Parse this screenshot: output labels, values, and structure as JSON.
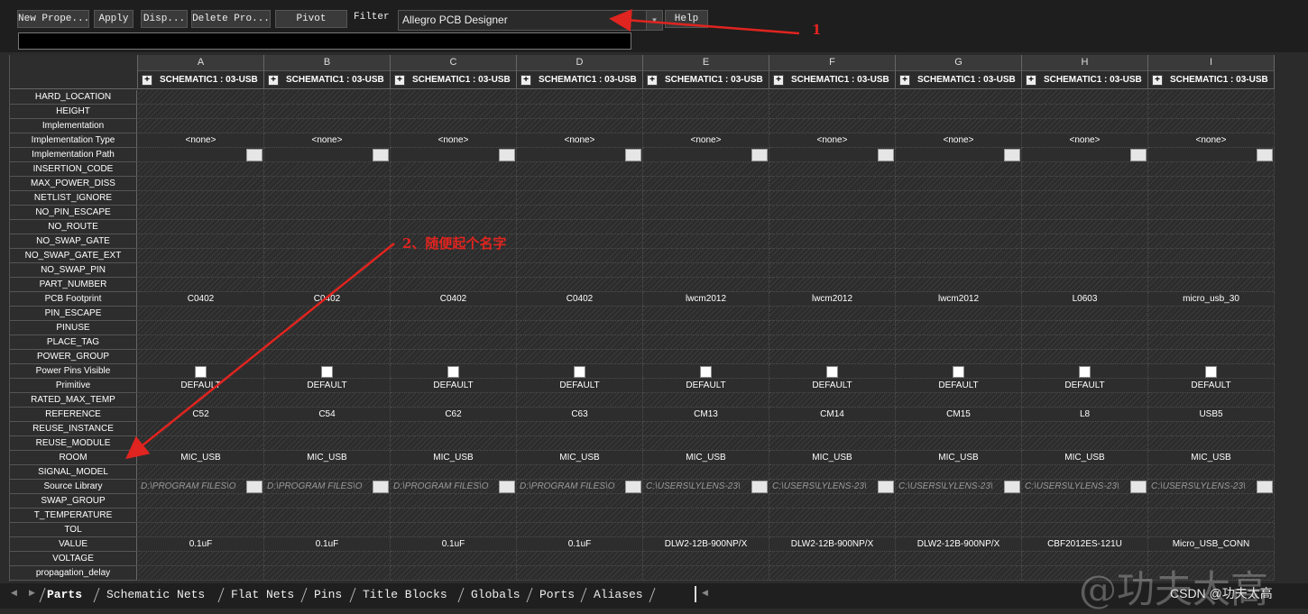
{
  "toolbar": {
    "new_property": "New Prope...",
    "apply": "Apply",
    "display": "Disp...",
    "delete_property": "Delete Pro...",
    "pivot": "Pivot",
    "filter_label": "Filter",
    "filter_value": "Allegro PCB Designer",
    "help": "Help"
  },
  "annotations": {
    "label1": "1",
    "label2": "2、随便起个名字",
    "color": "#e0241f"
  },
  "columns": [
    "A",
    "B",
    "C",
    "D",
    "E",
    "F",
    "G",
    "H",
    "I"
  ],
  "group_header": "SCHEMATIC1 : 03-USB",
  "rows": [
    "HARD_LOCATION",
    "HEIGHT",
    "Implementation",
    "Implementation Type",
    "Implementation Path",
    "INSERTION_CODE",
    "MAX_POWER_DISS",
    "NETLIST_IGNORE",
    "NO_PIN_ESCAPE",
    "NO_ROUTE",
    "NO_SWAP_GATE",
    "NO_SWAP_GATE_EXT",
    "NO_SWAP_PIN",
    "PART_NUMBER",
    "PCB Footprint",
    "PIN_ESCAPE",
    "PINUSE",
    "PLACE_TAG",
    "POWER_GROUP",
    "Power Pins Visible",
    "Primitive",
    "RATED_MAX_TEMP",
    "REFERENCE",
    "REUSE_INSTANCE",
    "REUSE_MODULE",
    "ROOM",
    "SIGNAL_MODEL",
    "Source Library",
    "SWAP_GROUP",
    "T_TEMPERATURE",
    "TOL",
    "VALUE",
    "VOLTAGE",
    "propagation_delay"
  ],
  "values": {
    "implementation_type": [
      "<none>",
      "<none>",
      "<none>",
      "<none>",
      "<none>",
      "<none>",
      "<none>",
      "<none>",
      "<none>"
    ],
    "pcb_footprint": [
      "C0402",
      "C0402",
      "C0402",
      "C0402",
      "lwcm2012",
      "lwcm2012",
      "lwcm2012",
      "L0603",
      "micro_usb_30"
    ],
    "primitive": [
      "DEFAULT",
      "DEFAULT",
      "DEFAULT",
      "DEFAULT",
      "DEFAULT",
      "DEFAULT",
      "DEFAULT",
      "DEFAULT",
      "DEFAULT"
    ],
    "reference": [
      "C52",
      "C54",
      "C62",
      "C63",
      "CM13",
      "CM14",
      "CM15",
      "L8",
      "USB5"
    ],
    "room": [
      "MIC_USB",
      "MIC_USB",
      "MIC_USB",
      "MIC_USB",
      "MIC_USB",
      "MIC_USB",
      "MIC_USB",
      "MIC_USB",
      "MIC_USB"
    ],
    "source_library": [
      "D:\\PROGRAM FILES\\O",
      "D:\\PROGRAM FILES\\O",
      "D:\\PROGRAM FILES\\O",
      "D:\\PROGRAM FILES\\O",
      "C:\\USERS\\LYLENS-23\\",
      "C:\\USERS\\LYLENS-23\\",
      "C:\\USERS\\LYLENS-23\\",
      "C:\\USERS\\LYLENS-23\\",
      "C:\\USERS\\LYLENS-23\\"
    ],
    "value": [
      "0.1uF",
      "0.1uF",
      "0.1uF",
      "0.1uF",
      "DLW2-12B-900NP/X",
      "DLW2-12B-900NP/X",
      "DLW2-12B-900NP/X",
      "CBF2012ES-121U",
      "Micro_USB_CONN"
    ]
  },
  "tabs": [
    "Parts",
    "Schematic Nets",
    "Flat Nets",
    "Pins",
    "Title Blocks",
    "Globals",
    "Ports",
    "Aliases"
  ],
  "watermark": {
    "big": "@功夫太高",
    "small": "CSDN @功夫太高"
  }
}
